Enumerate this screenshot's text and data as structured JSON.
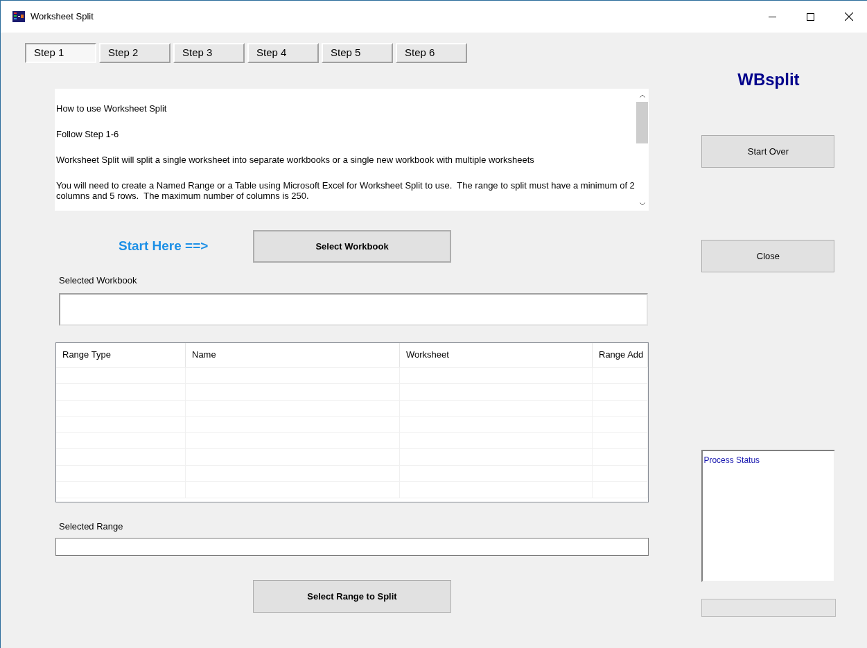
{
  "window": {
    "title": "Worksheet Split"
  },
  "tabs": [
    {
      "label": "Step 1",
      "selected": true
    },
    {
      "label": "Step 2",
      "selected": false
    },
    {
      "label": "Step 3",
      "selected": false
    },
    {
      "label": "Step 4",
      "selected": false
    },
    {
      "label": "Step 5",
      "selected": false
    },
    {
      "label": "Step 6",
      "selected": false
    }
  ],
  "instructions": [
    "How to use Worksheet Split",
    "Follow Step 1-6",
    "Worksheet Split will split a single worksheet into separate workbooks or a single new workbook with multiple worksheets",
    "You will need to create a Named Range or a Table using Microsoft Excel for Worksheet Split to use.  The range to split must have a minimum of 2 columns and 5 rows.  The maximum number of columns is 250."
  ],
  "start_hint": "Start Here ==>",
  "select_workbook_button": "Select Workbook",
  "selected_workbook": {
    "label": "Selected Workbook"
  },
  "table": {
    "columns": [
      "Range Type",
      "Name",
      "Worksheet",
      "Range Add"
    ]
  },
  "selected_range": {
    "label": "Selected Range"
  },
  "select_range_button": "Select Range to Split",
  "brand": "WBsplit",
  "side_buttons": [
    "Start Over",
    "Close"
  ],
  "process_status": {
    "title": "Process Status"
  }
}
